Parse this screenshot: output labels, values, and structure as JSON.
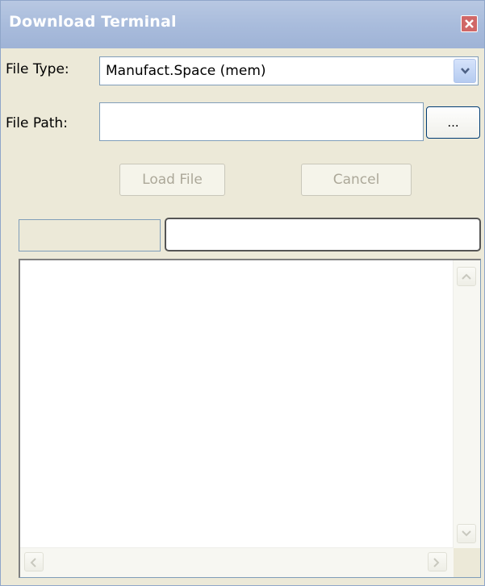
{
  "window": {
    "title": "Download Terminal",
    "close_icon": "close-icon"
  },
  "form": {
    "file_type_label": "File Type:",
    "file_type_value": "Manufact.Space (mem)",
    "file_path_label": "File Path:",
    "file_path_value": "",
    "browse_label": "...",
    "load_label": "Load File",
    "cancel_label": "Cancel"
  },
  "output": {
    "text": ""
  },
  "colors": {
    "titlebar": "#a9bcdc",
    "window_bg": "#ece9d8",
    "close_button": "#d06767",
    "input_border": "#7f9db9",
    "disabled_text": "#aca899"
  },
  "icons": {
    "dropdown": "chevron-down-icon",
    "scroll_up": "arrow-up-icon",
    "scroll_down": "arrow-down-icon",
    "scroll_left": "arrow-left-icon",
    "scroll_right": "arrow-right-icon"
  }
}
